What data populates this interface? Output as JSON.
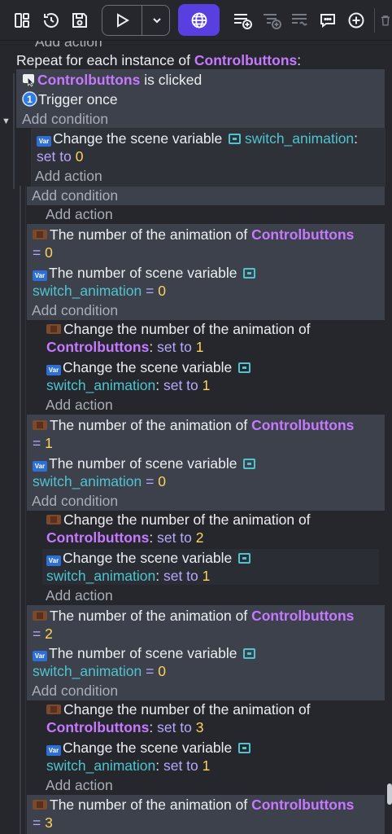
{
  "toolbar": {
    "icons": [
      "layout-icon",
      "history-icon",
      "save-icon",
      "play-icon",
      "chevron-down-icon",
      "globe-icon",
      "add-event-icon",
      "add-sub-event-icon",
      "add-group-icon",
      "add-comment-icon",
      "add-other-icon",
      "trash-icon"
    ]
  },
  "events": {
    "top_cut": "Add action",
    "repeat": {
      "prefix": "Repeat for each instance of ",
      "object": "Controlbuttons",
      "suffix": ":"
    },
    "cond1": {
      "object": "Controlbuttons",
      "text": " is clicked"
    },
    "cond2": {
      "text": "Trigger once"
    },
    "add_condition": "Add condition",
    "add_action": "Add action",
    "act_scene_var": {
      "text": "Change the scene variable ",
      "var": "switch_animation",
      "colon": ":",
      "set_to": "set to",
      "value": "0"
    },
    "subevents": [
      {
        "c1": {
          "text": "The number of the animation of ",
          "object": "Controlbuttons",
          "eq": "= ",
          "value": "0"
        },
        "c2": {
          "text": "The number of scene variable ",
          "var": "switch_animation",
          "eq": " = ",
          "value": "0"
        },
        "a1": {
          "text": "Change the number of the animation of",
          "object": "Controlbuttons",
          "colon": ": ",
          "set_to": "set to",
          "value": "1"
        },
        "a2": {
          "text": "Change the scene variable ",
          "var": "switch_animation",
          "colon": ": ",
          "set_to": "set to",
          "value": "1"
        }
      },
      {
        "c1": {
          "text": "The number of the animation of ",
          "object": "Controlbuttons",
          "eq": "= ",
          "value": "1"
        },
        "c2": {
          "text": "The number of scene variable ",
          "var": "switch_animation",
          "eq": " = ",
          "value": "0"
        },
        "a1": {
          "text": "Change the number of the animation of",
          "object": "Controlbuttons",
          "colon": ": ",
          "set_to": "set to",
          "value": "2"
        },
        "a2": {
          "text": "Change the scene variable ",
          "var": "switch_animation",
          "colon": ": ",
          "set_to": "set to",
          "value": "1"
        }
      },
      {
        "c1": {
          "text": "The number of the animation of ",
          "object": "Controlbuttons",
          "eq": "= ",
          "value": "2"
        },
        "c2": {
          "text": "The number of scene variable ",
          "var": "switch_animation",
          "eq": " = ",
          "value": "0"
        },
        "a1": {
          "text": "Change the number of the animation of",
          "object": "Controlbuttons",
          "colon": ": ",
          "set_to": "set to",
          "value": "3"
        },
        "a2": {
          "text": "Change the scene variable ",
          "var": "switch_animation",
          "colon": ": ",
          "set_to": "set to",
          "value": "1"
        }
      },
      {
        "c1": {
          "text": "The number of the animation of ",
          "object": "Controlbuttons",
          "eq": "= ",
          "value": "3"
        }
      }
    ]
  },
  "colors": {
    "object": "#c678ff",
    "variable": "#4fc4cf",
    "keyword": "#b9a6ff",
    "number": "#ffd25a",
    "preview_button": "#5a3fe0"
  }
}
